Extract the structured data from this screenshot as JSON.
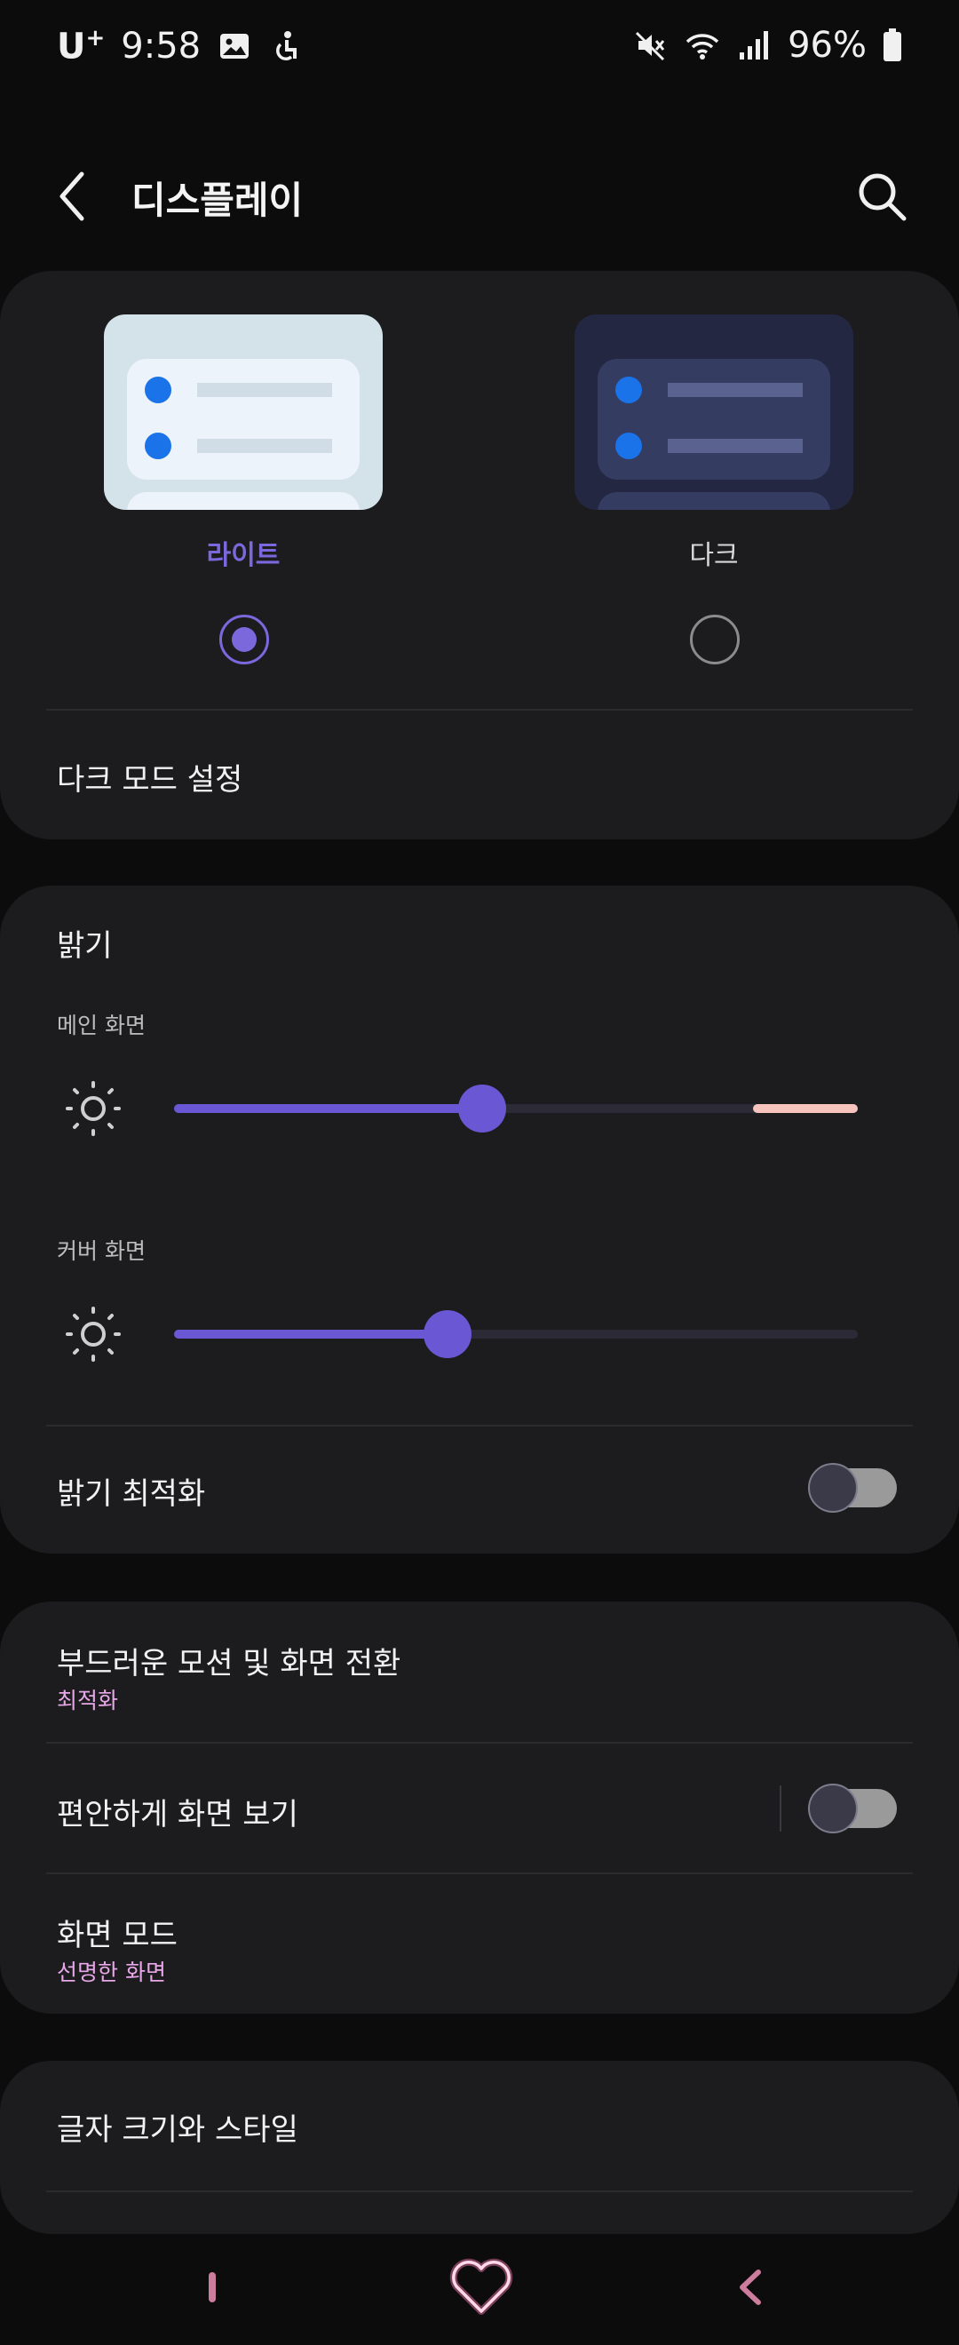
{
  "status_bar": {
    "carrier": "U",
    "carrier_sup": "+",
    "time": "9:58",
    "battery_text": "96%",
    "icons": [
      "gallery-icon",
      "accessibility-icon",
      "mute-icon",
      "wifi-icon",
      "signal-icon",
      "battery-icon"
    ]
  },
  "header": {
    "title": "디스플레이",
    "back_icon": "chevron-left-icon",
    "search_icon": "search-icon"
  },
  "theme": {
    "options": [
      {
        "label": "라이트",
        "selected": true
      },
      {
        "label": "다크",
        "selected": false
      }
    ],
    "dark_mode_settings": "다크 모드 설정"
  },
  "brightness": {
    "title": "밝기",
    "main_label": "메인 화면",
    "main_level": 0.45,
    "cover_label": "커버 화면",
    "cover_level": 0.4,
    "adaptive_label": "밝기 최적화",
    "adaptive_on": false
  },
  "motion": {
    "title": "부드러운 모션 및 화면 전환",
    "value": "최적화"
  },
  "eye_comfort": {
    "title": "편안하게 화면 보기",
    "on": false
  },
  "screen_mode": {
    "title": "화면 모드",
    "value": "선명한 화면"
  },
  "font": {
    "title": "글자 크기와 스타일"
  },
  "colors": {
    "accent": "#6a57d4",
    "subtext": "#e8a7e8",
    "card": "#1c1c1e",
    "background": "#0c0c0c"
  },
  "nav": {
    "recent_icon": "recent-apps-icon",
    "home_icon": "heart-home-icon",
    "back_icon": "back-icon"
  }
}
